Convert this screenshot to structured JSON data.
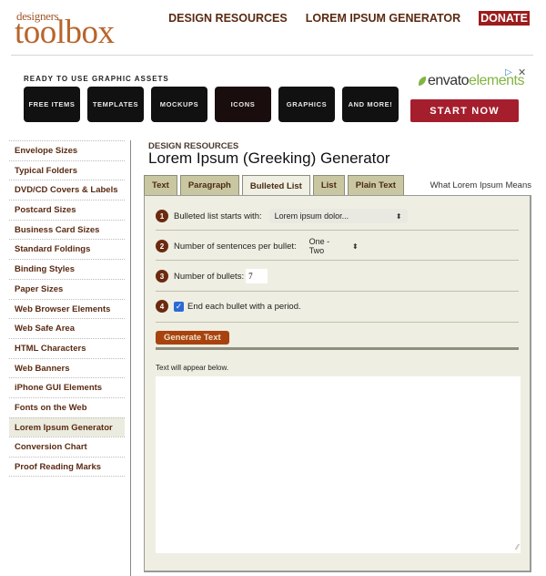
{
  "header": {
    "logo_small": "designers",
    "logo_big": "toolbox",
    "nav": [
      {
        "label": "DESIGN RESOURCES"
      },
      {
        "label": "LOREM IPSUM GENERATOR"
      },
      {
        "label": "DONATE"
      }
    ]
  },
  "ad": {
    "title": "READY TO USE GRAPHIC ASSETS",
    "tiles": [
      {
        "label": "FREE ITEMS"
      },
      {
        "label": "TEMPLATES"
      },
      {
        "label": "MOCKUPS"
      },
      {
        "label": "ICONS"
      },
      {
        "label": "GRAPHICS"
      },
      {
        "label": "AND MORE!"
      }
    ],
    "brand_prefix": "envato",
    "brand_suffix": "elements",
    "cta": "START NOW",
    "adchoice_icon": "▷",
    "close_icon": "✕"
  },
  "sidebar": {
    "items": [
      {
        "label": "Envelope Sizes"
      },
      {
        "label": "Typical Folders"
      },
      {
        "label": "DVD/CD Covers & Labels"
      },
      {
        "label": "Postcard Sizes"
      },
      {
        "label": "Business Card Sizes"
      },
      {
        "label": "Standard Foldings"
      },
      {
        "label": "Binding Styles"
      },
      {
        "label": "Paper Sizes"
      },
      {
        "label": "Web Browser Elements"
      },
      {
        "label": "Web Safe Area"
      },
      {
        "label": "HTML Characters"
      },
      {
        "label": "Web Banners"
      },
      {
        "label": "iPhone GUI Elements"
      },
      {
        "label": "Fonts on the Web"
      },
      {
        "label": "Lorem Ipsum Generator",
        "active": true
      },
      {
        "label": "Conversion Chart"
      },
      {
        "label": "Proof Reading Marks"
      }
    ]
  },
  "main": {
    "breadcrumb": "DESIGN RESOURCES",
    "title": "Lorem Ipsum (Greeking) Generator",
    "tabs": [
      {
        "label": "Text"
      },
      {
        "label": "Paragraph"
      },
      {
        "label": "Bulleted List",
        "active": true
      },
      {
        "label": "List"
      },
      {
        "label": "Plain Text"
      }
    ],
    "side_link": "What Lorem Ipsum Means",
    "form": {
      "step1": {
        "num": "1",
        "label": "Bulleted list starts with:",
        "value": "Lorem ipsum dolor..."
      },
      "step2": {
        "num": "2",
        "label": "Number of sentences per bullet:",
        "value": "One - Two"
      },
      "step3": {
        "num": "3",
        "label": "Number of bullets:",
        "value": "7"
      },
      "step4": {
        "num": "4",
        "label": "End each bullet with a period.",
        "checked": true
      },
      "generate_label": "Generate Text",
      "output_hint": "Text will appear below.",
      "output_value": ""
    }
  },
  "colors": {
    "brand_brown": "#5a2a12",
    "logo_orange": "#b8652b",
    "donate_red": "#9b1c1c",
    "panel_bg": "#efeee2",
    "tab_bg": "#c9c7a2",
    "generate_btn": "#a8430f",
    "cta_red": "#a51e2d"
  }
}
